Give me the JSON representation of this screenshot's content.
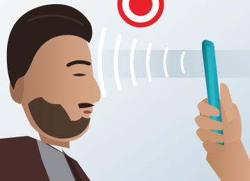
{
  "colors": {
    "background_light": "#eef2f4",
    "background_blue": "#c9d8e3",
    "signal_wave": "#ffffff",
    "recording_red": "#e8202a",
    "recording_ring": "#f3b9bd",
    "phone_teal": "#1aa3b5",
    "phone_dark": "#0d6f7c",
    "skin": "#c99676",
    "skin_shadow": "#9a6b50",
    "hair_beard": "#2a1f1a",
    "shirt_dark": "#4a2d2a",
    "collar_gray": "#8f8f96"
  },
  "icons": {
    "record": "record-icon"
  }
}
